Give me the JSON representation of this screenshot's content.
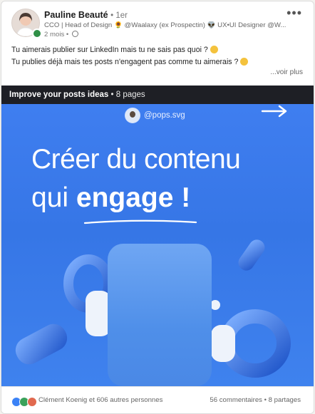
{
  "author": {
    "name": "Pauline Beauté",
    "degree": "• 1er",
    "headline": "CCO | Head of Design 🌻 @Waalaxy (ex Prospectin) 👽 UX•UI Designer @W...",
    "time": "2 mois •"
  },
  "post": {
    "line1": "Tu aimerais publier sur LinkedIn mais tu ne sais pas quoi ?",
    "line2": "Tu publies déjà mais tes posts n'engagent pas comme tu aimerais ?",
    "see_more": "...voir plus"
  },
  "document": {
    "title": "Improve your posts ideas",
    "pages": " • 8 pages",
    "slide": {
      "handle": "@pops.svg",
      "headline_line1": "Créer du contenu",
      "headline_line2_pre": "qui ",
      "headline_line2_bold": "engage",
      "headline_line2_post": " !"
    }
  },
  "social": {
    "reactors": "Clément Koenig et 606 autres personnes",
    "counts": "56 commentaires • 8 partages"
  },
  "icons": [
    "globe-icon",
    "more-options-icon",
    "arrow-right-icon",
    "like-icon",
    "celebrate-icon",
    "love-icon"
  ],
  "colors": {
    "slide_bg": "#3676e6",
    "doc_titlebar": "#1e1f25",
    "online_status": "#2f8f46"
  }
}
